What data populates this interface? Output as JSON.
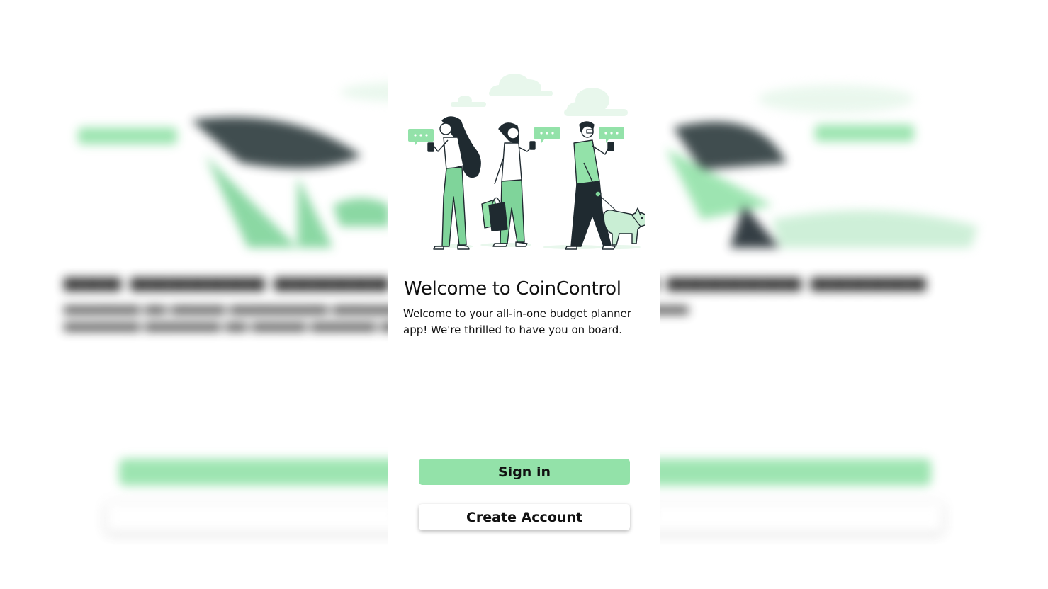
{
  "welcome": {
    "title": "Welcome to CoinControl",
    "subtitle": "Welcome to your all-in-one budget planner app! We're thrilled to have you on board."
  },
  "actions": {
    "sign_in_label": "Sign in",
    "create_account_label": "Create Account"
  },
  "colors": {
    "accent": "#93e2a9",
    "accent_light": "#e8f7ec",
    "ink": "#1f2a30",
    "background": "#ffffff"
  },
  "illustration": {
    "icons": [
      "chat-bubble-icon",
      "smartphone-icon",
      "shopping-bag-icon",
      "dog-icon",
      "cloud-icon"
    ]
  }
}
